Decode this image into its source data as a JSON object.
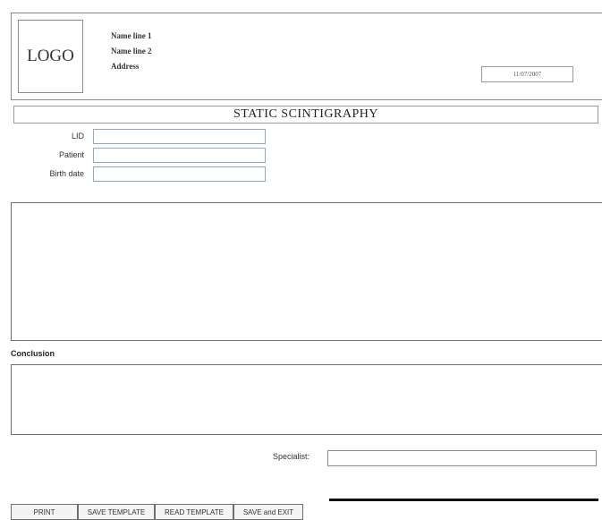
{
  "header": {
    "logo": "LOGO",
    "name_line_1": "Name line 1",
    "name_line_2": "Name line 2",
    "address": "Address",
    "date": "11/07/2007"
  },
  "title": "STATIC SCINTIGRAPHY",
  "fields": {
    "lid_label": "LID",
    "patient_label": "Patient",
    "birth_date_label": "Birth date",
    "lid_value": "",
    "patient_value": "",
    "birth_date_value": ""
  },
  "conclusion_label": "Conclusion",
  "specialist_label": "Specialist:",
  "buttons": {
    "print": "PRINT",
    "save_template": "SAVE TEMPLATE",
    "read_template": "READ TEMPLATE",
    "save_and_exit": "SAVE and EXIT"
  }
}
